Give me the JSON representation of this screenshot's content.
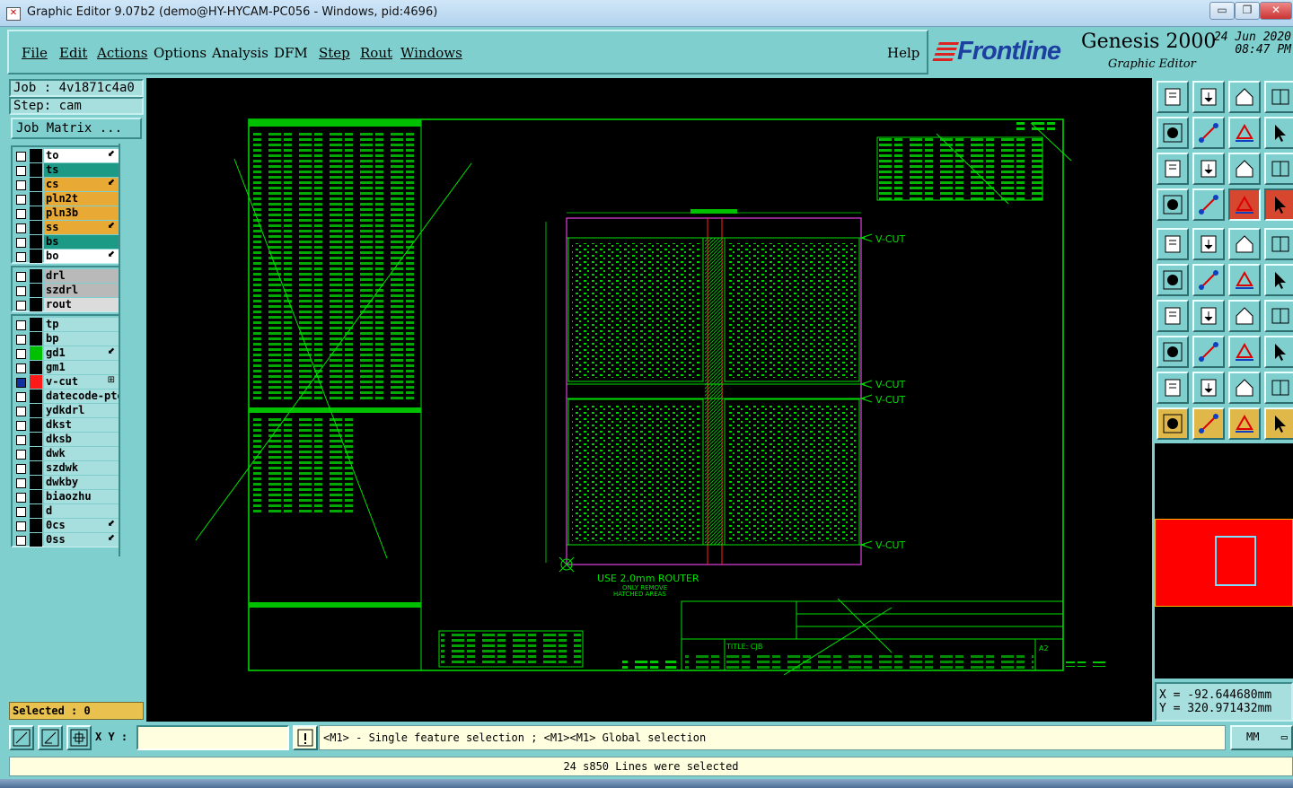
{
  "window": {
    "title": "Graphic Editor 9.07b2 (demo@HY-HYCAM-PC056 - Windows, pid:4696)",
    "buttons": [
      "▭",
      "❐",
      "✕"
    ]
  },
  "menu": {
    "items": [
      "File",
      "Edit",
      "Actions",
      "Options",
      "Analysis",
      "DFM",
      "Step",
      "Rout",
      "Windows"
    ],
    "help": "Help"
  },
  "brand": {
    "logo": "Frontline",
    "product": "Genesis 2000",
    "subtitle": "Graphic Editor",
    "date": "24 Jun 2020",
    "time": "08:47 PM"
  },
  "job": {
    "job_label": "Job : 4v1871c4a0",
    "step_label": "Step: cam",
    "matrix_button": "Job Matrix ..."
  },
  "layers": {
    "group1": [
      {
        "name": "to",
        "color": "#ffffff",
        "mark": "⬋"
      },
      {
        "name": "ts",
        "color": "#1d9a86",
        "mark": ""
      },
      {
        "name": "cs",
        "color": "#e8a935",
        "mark": "⬋"
      },
      {
        "name": "pln2t",
        "color": "#e8a935",
        "mark": ""
      },
      {
        "name": "pln3b",
        "color": "#e8a935",
        "mark": ""
      },
      {
        "name": "ss",
        "color": "#e8a935",
        "mark": "⬋"
      },
      {
        "name": "bs",
        "color": "#1d9a86",
        "mark": ""
      },
      {
        "name": "bo",
        "color": "#ffffff",
        "mark": "⬋"
      }
    ],
    "group2": [
      {
        "name": "drl",
        "color": "#b9b9b9",
        "mark": ""
      },
      {
        "name": "szdrl",
        "color": "#b9b9b9",
        "mark": ""
      },
      {
        "name": "rout",
        "color": "#dcdcdc",
        "mark": ""
      }
    ],
    "group3": [
      {
        "name": "tp",
        "color": "#a7dede",
        "mark": ""
      },
      {
        "name": "bp",
        "color": "#a7dede",
        "mark": ""
      },
      {
        "name": "gd1",
        "color": "#a7dede",
        "mark": "⬋",
        "swatch": "#00c000"
      },
      {
        "name": "gm1",
        "color": "#a7dede",
        "mark": ""
      },
      {
        "name": "v-cut",
        "color": "#a7dede",
        "mark": "⊞",
        "swatch": "#ff1a1a",
        "checked": true
      },
      {
        "name": "datecode-pte",
        "color": "#a7dede",
        "mark": ""
      },
      {
        "name": "ydkdrl",
        "color": "#a7dede",
        "mark": ""
      },
      {
        "name": "dkst",
        "color": "#a7dede",
        "mark": ""
      },
      {
        "name": "dksb",
        "color": "#a7dede",
        "mark": ""
      },
      {
        "name": "dwk",
        "color": "#a7dede",
        "mark": ""
      },
      {
        "name": "szdwk",
        "color": "#a7dede",
        "mark": ""
      },
      {
        "name": "dwkby",
        "color": "#a7dede",
        "mark": ""
      },
      {
        "name": "biaozhu",
        "color": "#a7dede",
        "mark": ""
      },
      {
        "name": "d",
        "color": "#a7dede",
        "mark": ""
      },
      {
        "name": "0cs",
        "color": "#a7dede",
        "mark": "⬋"
      },
      {
        "name": "0ss",
        "color": "#a7dede",
        "mark": "⬋"
      }
    ]
  },
  "canvas": {
    "vcut_labels": [
      "V-CUT",
      "V-CUT",
      "V-CUT",
      "V-CUT"
    ],
    "router_note": "USE 2.0mm ROUTER",
    "router_note2": "ONLY REMOVE",
    "router_note3": "HATCHED AREAS",
    "title_label": "TITLE: CJB",
    "rev_label": "A2"
  },
  "coords": {
    "x": "X = -92.644680mm",
    "y": "Y = 320.971432mm"
  },
  "selected": "Selected : 0",
  "cmd": {
    "xy_label": "X Y :",
    "xy_value": "",
    "hint": "<M1> - Single feature selection ; <M1><M1> Global selection",
    "units": "MM"
  },
  "status": "24 s850 Lines were selected"
}
